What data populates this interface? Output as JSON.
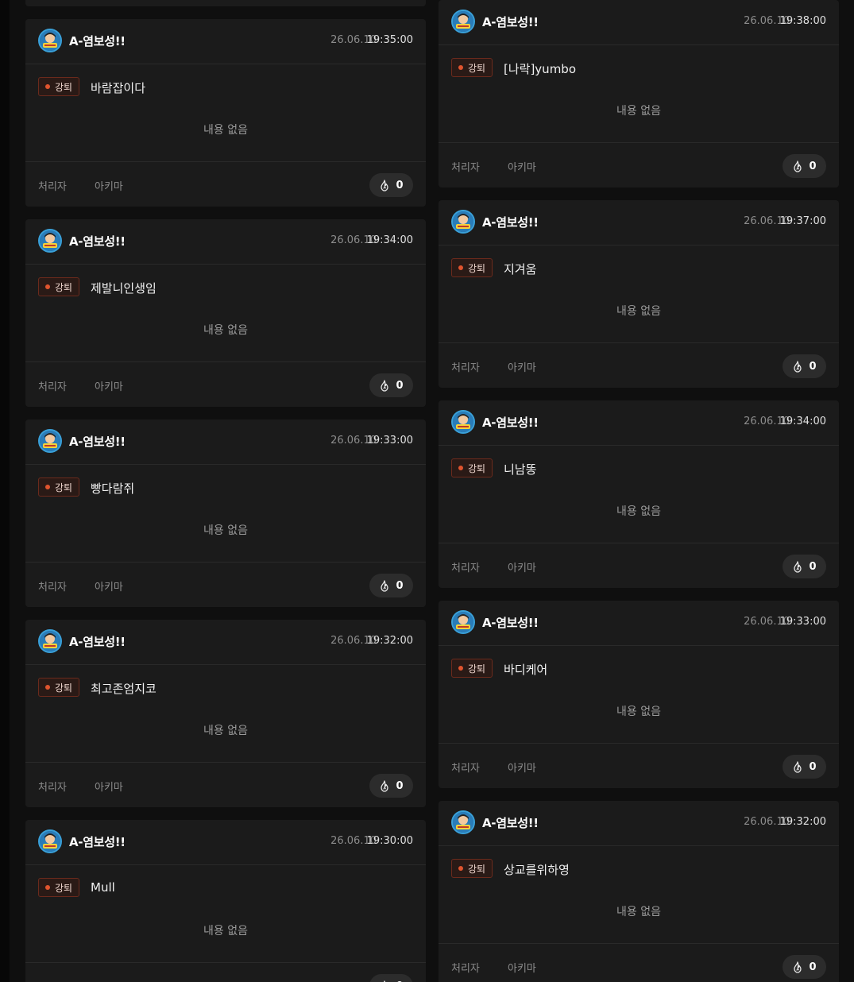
{
  "common": {
    "author": "A-염보성!!",
    "tag_label": "강퇴",
    "empty_text": "내용 없음",
    "handler_label": "처리자",
    "handler_name": "아키마",
    "like_count": "0"
  },
  "left_cards": [
    {
      "date": "26.06.10",
      "time": "19:35:00",
      "title": "바람잡이다"
    },
    {
      "date": "26.06.10",
      "time": "19:34:00",
      "title": "제발니인생임"
    },
    {
      "date": "26.06.10",
      "time": "19:33:00",
      "title": "빵다람쥐"
    },
    {
      "date": "26.06.10",
      "time": "19:32:00",
      "title": "최고존엄지코"
    },
    {
      "date": "26.06.10",
      "time": "19:30:00",
      "title": "Mull"
    }
  ],
  "right_cards": [
    {
      "date": "26.06.10",
      "time": "19:38:00",
      "title": "[나락]yumbo"
    },
    {
      "date": "26.06.10",
      "time": "19:37:00",
      "title": "지겨움"
    },
    {
      "date": "26.06.10",
      "time": "19:34:00",
      "title": "니남똥"
    },
    {
      "date": "26.06.10",
      "time": "19:33:00",
      "title": "바디케어"
    },
    {
      "date": "26.06.10",
      "time": "19:32:00",
      "title": "상교를위하영"
    }
  ],
  "colors": {
    "background": "#0f0f0f",
    "card": "#1b1b1b",
    "tag_dot": "#e0542e",
    "tag_border": "#6b2a1c"
  }
}
